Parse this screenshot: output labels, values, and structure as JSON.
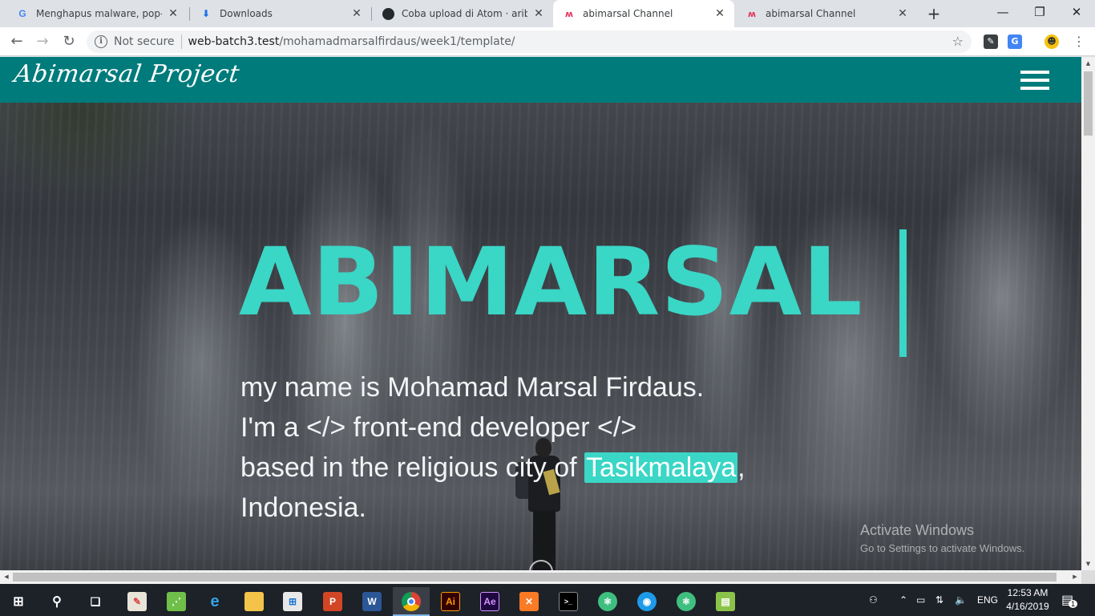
{
  "browser": {
    "tabs": [
      {
        "title": "Menghapus malware, pop-up iklan",
        "favicon": "google-icon",
        "active": false
      },
      {
        "title": "Downloads",
        "favicon": "download-icon",
        "active": false
      },
      {
        "title": "Coba upload di Atom · aribahtiar",
        "favicon": "github-icon",
        "active": false
      },
      {
        "title": "abimarsal Channel",
        "favicon": "m-logo-icon",
        "active": true
      },
      {
        "title": "abimarsal Channel",
        "favicon": "m-logo-icon",
        "active": false
      }
    ],
    "new_tab": "+",
    "window_controls": {
      "minimize": "—",
      "maximize": "❐",
      "close": "✕"
    },
    "address": {
      "security_label": "Not secure",
      "host": "web-batch3.test",
      "path": "/mohamadmarsalfirdaus/week1/template/"
    }
  },
  "page": {
    "brand": "Abimarsal Project",
    "hero_title": "ABIMARSAL",
    "intro_lines": {
      "line1": "my name is Mohamad Marsal Firdaus.",
      "line2": "I'm a </> front-end developer </>",
      "line3_before": "based in the religious city of ",
      "line3_highlight": "Tasikmalaya",
      "line3_after": ",",
      "line4": "Indonesia."
    },
    "colors": {
      "nav_bg": "#007b7b",
      "accent": "#3ad6c6"
    }
  },
  "watermark": {
    "line1": "Activate Windows",
    "line2": "Go to Settings to activate Windows."
  },
  "taskbar": {
    "apps": [
      {
        "name": "start-icon"
      },
      {
        "name": "search-icon"
      },
      {
        "name": "task-view-icon"
      },
      {
        "name": "paint-icon"
      },
      {
        "name": "app-green-icon"
      },
      {
        "name": "internet-explorer-icon"
      },
      {
        "name": "file-explorer-icon"
      },
      {
        "name": "store-icon"
      },
      {
        "name": "powerpoint-icon",
        "label": "P"
      },
      {
        "name": "word-icon",
        "label": "W"
      },
      {
        "name": "chrome-icon"
      },
      {
        "name": "illustrator-icon",
        "label": "Ai"
      },
      {
        "name": "after-effects-icon",
        "label": "Ae"
      },
      {
        "name": "xampp-icon"
      },
      {
        "name": "terminal-icon"
      },
      {
        "name": "atom-icon"
      },
      {
        "name": "app-blue-icon"
      },
      {
        "name": "atom-icon-2"
      },
      {
        "name": "notepad-icon"
      }
    ],
    "language": "ENG",
    "time": "12:53 AM",
    "date": "4/16/2019",
    "notifications": "1"
  }
}
